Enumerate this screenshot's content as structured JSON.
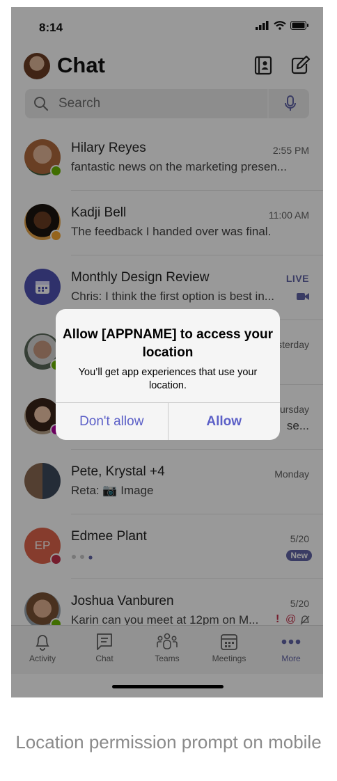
{
  "status_bar": {
    "time": "8:14"
  },
  "header": {
    "title": "Chat"
  },
  "search": {
    "placeholder": "Search"
  },
  "chats": [
    {
      "name": "Hilary Reyes",
      "time": "2:55 PM",
      "preview": "fantastic news on the marketing presen...",
      "presence": "available"
    },
    {
      "name": "Kadji Bell",
      "time": "11:00 AM",
      "preview": "The feedback I handed over was final.",
      "presence": "away"
    },
    {
      "name": "Monthly Design Review",
      "time": "LIVE",
      "preview": "Chris: I think the first option is best in...",
      "presence": "meeting"
    },
    {
      "name": "",
      "time": "Yesterday",
      "preview": "",
      "presence": "available"
    },
    {
      "name": "",
      "time": "Thursday",
      "preview": "se...",
      "presence": "ooo"
    },
    {
      "name": "Pete, Krystal +4",
      "time": "Monday",
      "preview": "Reta: 📷 Image",
      "presence": ""
    },
    {
      "name": "Edmee Plant",
      "time": "5/20",
      "preview": "",
      "initials": "EP",
      "badge": "New",
      "presence": "dnd"
    },
    {
      "name": "Joshua Vanburen",
      "time": "5/20",
      "preview": "Karin can you meet at 12pm on M...",
      "presence": "available"
    }
  ],
  "tabs": [
    {
      "label": "Activity",
      "icon": "bell-icon"
    },
    {
      "label": "Chat",
      "icon": "chat-icon"
    },
    {
      "label": "Teams",
      "icon": "teams-icon"
    },
    {
      "label": "Meetings",
      "icon": "calendar-icon"
    },
    {
      "label": "More",
      "icon": "more-icon"
    }
  ],
  "dialog": {
    "title": "Allow [APPNAME] to access your location",
    "message": "You’ll get app experiences that use your location.",
    "deny_label": "Don't allow",
    "allow_label": "Allow"
  },
  "caption": "Location permission prompt on mobile",
  "colors": {
    "accent": "#6264a7",
    "available": "#6bb700",
    "away": "#f8a731",
    "dnd": "#c4314b",
    "ooo": "#b4009e"
  }
}
